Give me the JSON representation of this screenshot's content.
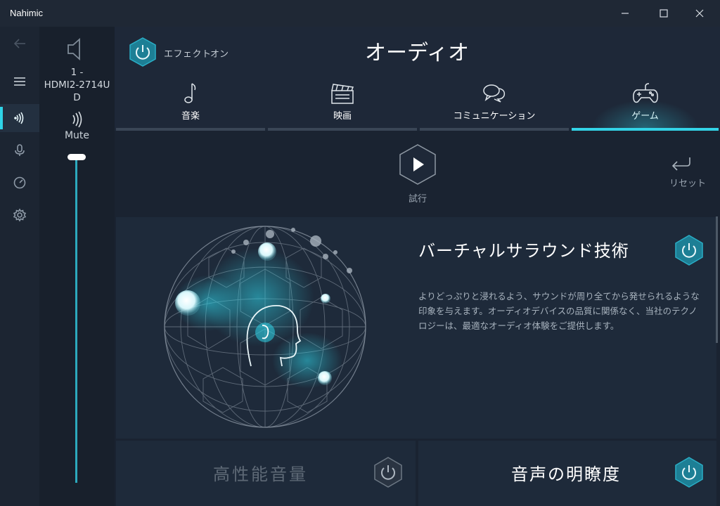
{
  "window": {
    "title": "Nahimic",
    "minimize_icon": "minimize-icon",
    "maximize_icon": "maximize-icon",
    "close_icon": "close-icon"
  },
  "rail": {
    "items": [
      "back-arrow-icon",
      "menu-icon",
      "audio-waves-icon",
      "microphone-icon",
      "gauge-icon",
      "gear-icon"
    ],
    "active": "audio-waves-icon"
  },
  "device": {
    "name": "1 - HDMI2-2714U D",
    "name_lines": [
      "1 -",
      "HDMI2-2714U",
      "D"
    ],
    "status": "Mute",
    "volume": 1.0
  },
  "header": {
    "effect_label": "エフェクト",
    "effect_state": "オン",
    "title": "オーディオ"
  },
  "tabs": [
    {
      "label": "音楽",
      "icon": "music-note-icon",
      "active": false
    },
    {
      "label": "映画",
      "icon": "clapperboard-icon",
      "active": false
    },
    {
      "label": "コミュニケーション",
      "icon": "chat-bubbles-icon",
      "active": false
    },
    {
      "label": "ゲーム",
      "icon": "gamepad-icon",
      "active": true
    }
  ],
  "controls": {
    "play_label": "試行",
    "reset_label": "リセット"
  },
  "surround": {
    "title": "バーチャルサラウンド技術",
    "description": "よりどっぷりと浸れるよう、サウンドが周り全てから発せられるような印象を与えます。オーディオデバイスの品質に関係なく、当社のテクノロジーは、最適なオーディオ体験をご提供します。",
    "enabled": true
  },
  "features": [
    {
      "title": "高性能音量",
      "enabled": false
    },
    {
      "title": "音声の明瞭度",
      "enabled": true
    }
  ],
  "colors": {
    "accent": "#33d3e6",
    "power_on": "#1d7f95",
    "power_off": "#3a4452"
  }
}
